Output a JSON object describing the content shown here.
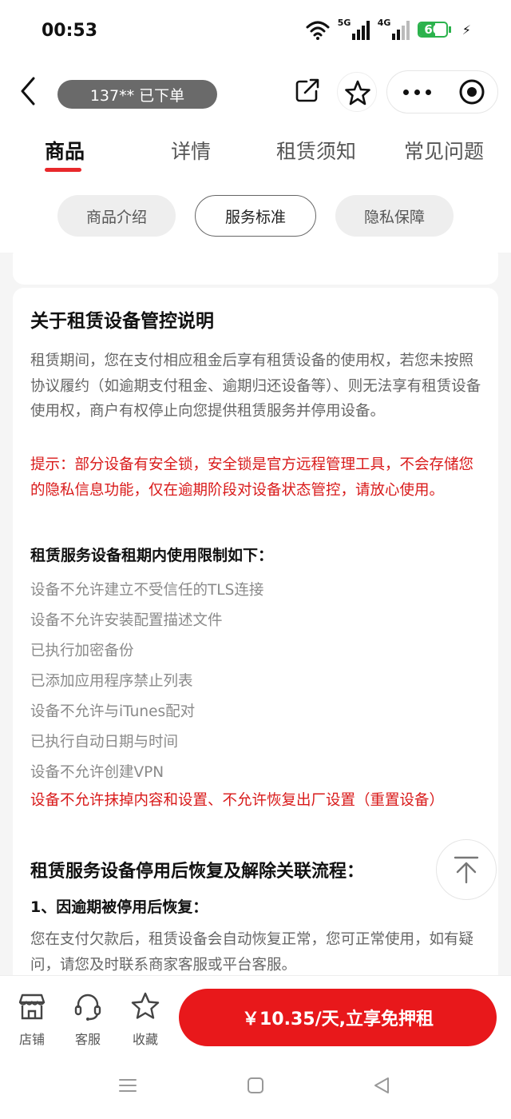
{
  "status_bar": {
    "time": "00:53",
    "wifi_icon": "wifi-icon",
    "signal_1_label": "5G",
    "signal_2_label": "4G",
    "battery_level": "60",
    "battery_fraction": 0.6,
    "charging_icon": "bolt-icon"
  },
  "header": {
    "order_notice": "137** 已下单",
    "icons": [
      "back-arrow-icon",
      "share-icon",
      "star-icon",
      "more-dots-icon",
      "close-circle-icon"
    ]
  },
  "tabs": [
    {
      "label": "商品",
      "active": true
    },
    {
      "label": "详情",
      "active": false
    },
    {
      "label": "租赁须知",
      "active": false
    },
    {
      "label": "常见问题",
      "active": false
    }
  ],
  "subtabs": [
    {
      "label": "商品介绍",
      "active": false
    },
    {
      "label": "服务标准",
      "active": true
    },
    {
      "label": "隐私保障",
      "active": false
    }
  ],
  "content": {
    "title": "关于租赁设备管控说明",
    "paragraph_1": "租赁期间，您在支付相应租金后享有租赁设备的使用权，若您未按照协议履约（如逾期支付租金、逾期归还设备等）、则无法享有租赁设备使用权，商户有权停止向您提供租赁服务并停用设备。",
    "tip": "提示：部分设备有安全锁，安全锁是官方远程管理工具，不会存储您的隐私信息功能，仅在逾期阶段对设备状态管控，请放心使用。",
    "restrictions_title": "租赁服务设备租期内使用限制如下：",
    "restrictions": [
      "设备不允许建立不受信任的TLS连接",
      "设备不允许安装配置描述文件",
      "已执行加密备份",
      "已添加应用程序禁止列表",
      "设备不允许与iTunes配对",
      "已执行自动日期与时间",
      "设备不允许创建VPN"
    ],
    "restriction_red": "设备不允许抹掉内容和设置、不允许恢复出厂设置（重置设备）",
    "recovery_title": "租赁服务设备停用后恢复及解除关联流程：",
    "recovery_step_title": "1、因逾期被停用后恢复：",
    "recovery_step_text": "您在支付欠款后，租赁设备会自动恢复正常，您可正常使用，如有疑问，请您及时联系商家客服或平台客服。"
  },
  "bottom_bar": {
    "shop_label": "店铺",
    "service_label": "客服",
    "favorite_label": "收藏",
    "rent_button": "￥10.35/天,立享免押租"
  },
  "colors": {
    "accent_red": "#e8181b",
    "tip_red": "#d91a1a",
    "battery_green": "#2bb24c"
  }
}
